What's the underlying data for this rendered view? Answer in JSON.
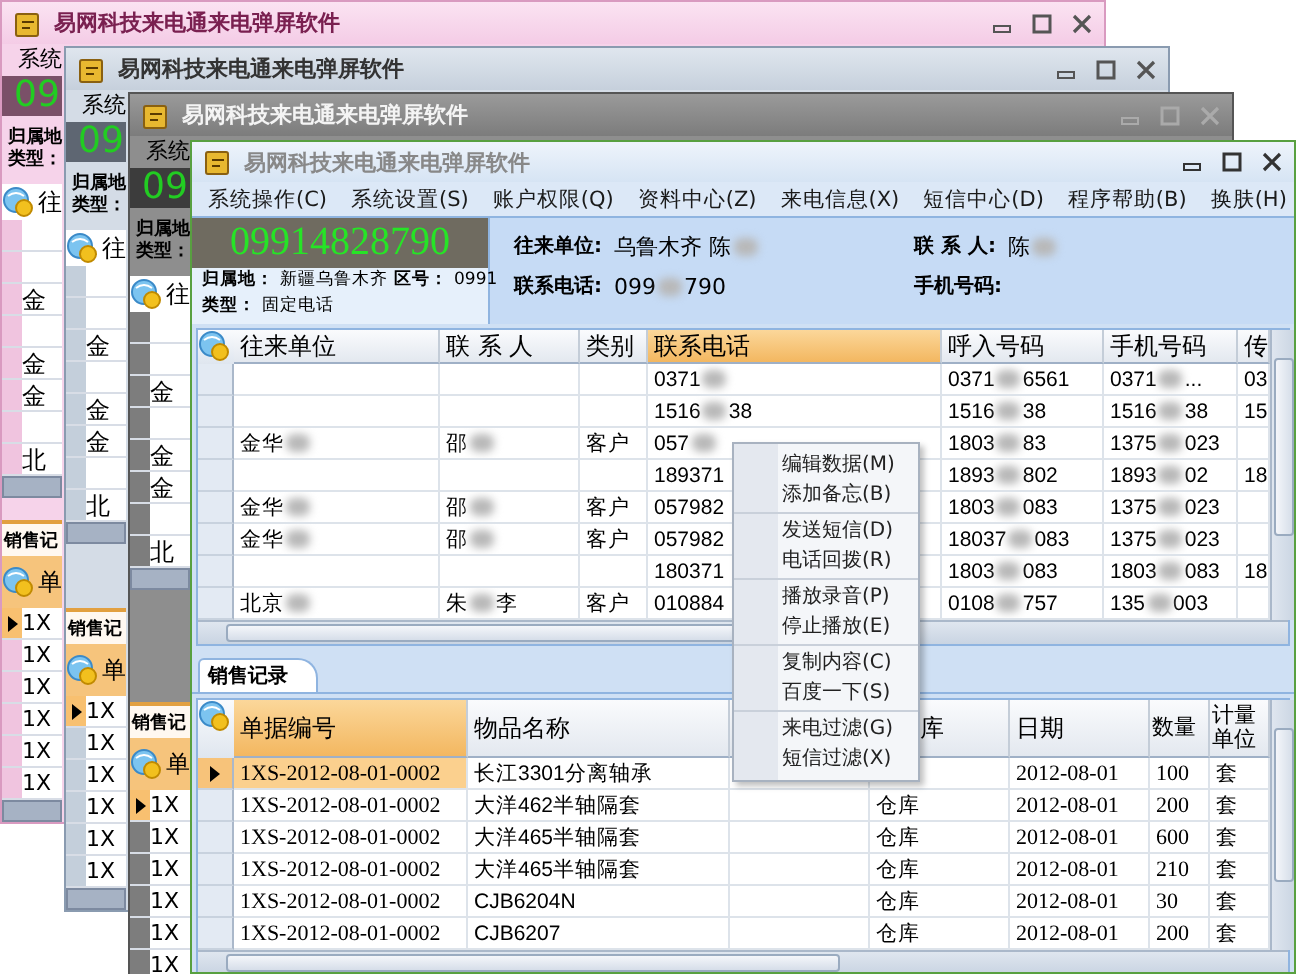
{
  "back_windows": [
    {
      "kind": "pink",
      "title": "易网科技来电通来电弹屏软件",
      "menu_fragment": "系统",
      "number_fragment": "09",
      "place_label": "归属地",
      "type_label": "类型：",
      "header_fragment": "往",
      "rows": [
        "",
        "",
        "金",
        "",
        "金",
        "金",
        "",
        "北"
      ],
      "tab_fragment": "销售记",
      "lower_header_fragment": "单",
      "lower_rows": [
        "1X",
        "1X",
        "1X",
        "1X",
        "1X",
        "1X"
      ]
    },
    {
      "kind": "slate",
      "title": "易网科技来电通来电弹屏软件",
      "menu_fragment": "系统",
      "number_fragment": "09",
      "place_label": "归属地",
      "type_label": "类型：",
      "header_fragment": "往",
      "rows": [
        "",
        "",
        "金",
        "",
        "金",
        "金",
        "",
        "北"
      ],
      "tab_fragment": "销售记",
      "lower_header_fragment": "单",
      "lower_rows": [
        "1X",
        "1X",
        "1X",
        "1X",
        "1X",
        "1X"
      ]
    },
    {
      "kind": "graphite",
      "title": "易网科技来电通来电弹屏软件",
      "menu_fragment": "系统",
      "number_fragment": "09",
      "place_label": "归属地",
      "type_label": "类型：",
      "header_fragment": "往",
      "rows": [
        "",
        "",
        "金",
        "",
        "金",
        "金",
        "",
        "北"
      ],
      "tab_fragment": "销售记",
      "lower_header_fragment": "单",
      "lower_rows": [
        "1X",
        "1X",
        "1X",
        "1X",
        "1X",
        "1X"
      ]
    }
  ],
  "window": {
    "title": "易网科技来电通来电弹屏软件"
  },
  "menu": [
    "系统操作(C)",
    "系统设置(S)",
    "账户权限(Q)",
    "资料中心(Z)",
    "来电信息(X)",
    "短信中心(D)",
    "程序帮助(B)"
  ],
  "skin_menu": "换肤(H)",
  "caller": {
    "number": "09914828790",
    "place_label": "归属地：",
    "place": "新疆乌鲁木齐",
    "area_label": "区号：",
    "area": "0991",
    "type_label": "类型：",
    "type": "固定电话"
  },
  "details": [
    {
      "label": "往来单位:",
      "parts": [
        "乌鲁木齐  陈"
      ]
    },
    {
      "label": "联 系 人:",
      "parts": [
        "陈"
      ]
    },
    {
      "label": "联系电话:",
      "parts": [
        "099",
        "790"
      ]
    },
    {
      "label": "手机号码:"
    }
  ],
  "contacts": {
    "columns": [
      {
        "label": "往来单位",
        "selected": false
      },
      {
        "label": "联 系 人",
        "selected": false
      },
      {
        "label": "类别",
        "selected": false
      },
      {
        "label": "联系电话",
        "selected": true
      },
      {
        "label": "呼入号码",
        "selected": false
      },
      {
        "label": "手机号码",
        "selected": false
      },
      {
        "label": "传",
        "selected": false
      }
    ],
    "rows": [
      [
        null,
        null,
        null,
        {
          "parts": [
            "0371"
          ]
        },
        {
          "parts": [
            "0371",
            "6561"
          ]
        },
        {
          "parts": [
            "0371",
            "..."
          ]
        },
        "03"
      ],
      [
        null,
        null,
        null,
        {
          "parts": [
            "1516",
            "38"
          ]
        },
        {
          "parts": [
            "1516",
            "38"
          ]
        },
        {
          "parts": [
            "1516",
            "38"
          ]
        },
        "15"
      ],
      [
        {
          "parts": [
            "金华"
          ]
        },
        {
          "parts": [
            "邵"
          ]
        },
        "客户",
        {
          "parts": [
            "057"
          ]
        },
        {
          "parts": [
            "1803",
            "83"
          ]
        },
        {
          "parts": [
            "1375",
            "023"
          ]
        },
        null
      ],
      [
        null,
        null,
        null,
        "189371",
        {
          "parts": [
            "1893",
            "802"
          ]
        },
        {
          "parts": [
            "1893",
            "02"
          ]
        },
        "18"
      ],
      [
        {
          "parts": [
            "金华"
          ]
        },
        {
          "parts": [
            "邵"
          ]
        },
        "客户",
        "057982",
        {
          "parts": [
            "1803",
            "083"
          ]
        },
        {
          "parts": [
            "1375",
            "023"
          ]
        },
        null
      ],
      [
        {
          "parts": [
            "金华"
          ]
        },
        {
          "parts": [
            "邵"
          ]
        },
        "客户",
        "057982",
        {
          "parts": [
            "18037",
            "083"
          ]
        },
        {
          "parts": [
            "1375",
            "023"
          ]
        },
        null
      ],
      [
        null,
        null,
        null,
        "180371",
        {
          "parts": [
            "1803",
            "083"
          ]
        },
        {
          "parts": [
            "1803",
            "083"
          ]
        },
        "18"
      ],
      [
        {
          "parts": [
            "北京"
          ]
        },
        {
          "parts": [
            "朱",
            "李"
          ]
        },
        "客户",
        "010884",
        {
          "parts": [
            "0108",
            "757"
          ]
        },
        {
          "parts": [
            "135",
            "003"
          ]
        },
        null
      ]
    ]
  },
  "tab": {
    "label": "销售记录",
    "selected": true
  },
  "sales": {
    "columns": [
      {
        "label": "单据编号",
        "selected": true
      },
      {
        "label": "物品名称",
        "selected": false
      },
      {},
      {
        "label": "库",
        "selected": false
      },
      {
        "label": "日期",
        "selected": false
      },
      {
        "label": "数量",
        "selected": false
      },
      {
        "label": "计量单位",
        "selected": false
      }
    ],
    "rows": [
      {
        "selected": true,
        "cells": [
          "1XS-2012-08-01-0002",
          "长江3301分离轴承",
          null,
          null,
          "2012-08-01",
          "100",
          "套"
        ]
      },
      {
        "selected": false,
        "cells": [
          "1XS-2012-08-01-0002",
          "大洋462半轴隔套",
          null,
          "仓库",
          "2012-08-01",
          "200",
          "套"
        ]
      },
      {
        "selected": false,
        "cells": [
          "1XS-2012-08-01-0002",
          "大洋465半轴隔套",
          null,
          "仓库",
          "2012-08-01",
          "600",
          "套"
        ]
      },
      {
        "selected": false,
        "cells": [
          "1XS-2012-08-01-0002",
          "大洋465半轴隔套",
          null,
          "仓库",
          "2012-08-01",
          "210",
          "套"
        ]
      },
      {
        "selected": false,
        "cells": [
          "1XS-2012-08-01-0002",
          "CJB6204N",
          null,
          "仓库",
          "2012-08-01",
          "30",
          "套"
        ]
      },
      {
        "selected": false,
        "cells": [
          "1XS-2012-08-01-0002",
          "CJB6207",
          null,
          "仓库",
          "2012-08-01",
          "200",
          "套"
        ]
      }
    ]
  },
  "context_menu": [
    [
      "编辑数据(M)",
      "添加备忘(B)"
    ],
    [
      "发送短信(D)",
      "电话回拨(R)"
    ],
    [
      "播放录音(P)",
      "停止播放(E)"
    ],
    [
      "复制内容(C)",
      "百度一下(S)"
    ],
    [
      "来电过滤(G)",
      "短信过滤(X)"
    ]
  ]
}
